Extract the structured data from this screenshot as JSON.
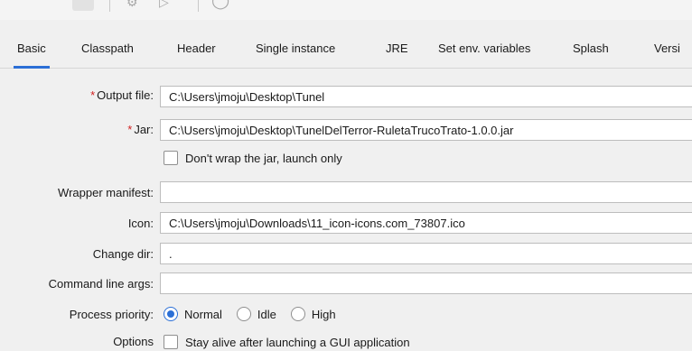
{
  "tabs": [
    {
      "label": "Basic",
      "active": true
    },
    {
      "label": "Classpath"
    },
    {
      "label": "Header"
    },
    {
      "label": "Single instance"
    },
    {
      "label": "JRE"
    },
    {
      "label": "Set env. variables"
    },
    {
      "label": "Splash"
    },
    {
      "label": "Versi"
    }
  ],
  "form": {
    "output_file": {
      "label": "Output file:",
      "required": "*",
      "value": "C:\\Users\\jmoju\\Desktop\\Tunel"
    },
    "jar": {
      "label": "Jar:",
      "required": "*",
      "value": "C:\\Users\\jmoju\\Desktop\\TunelDelTerror-RuletaTrucoTrato-1.0.0.jar"
    },
    "dont_wrap": {
      "label": "Don't wrap the jar, launch only",
      "checked": false
    },
    "wrapper_manifest": {
      "label": "Wrapper manifest:",
      "value": ""
    },
    "icon": {
      "label": "Icon:",
      "value": "C:\\Users\\jmoju\\Downloads\\11_icon-icons.com_73807.ico"
    },
    "change_dir": {
      "label": "Change dir:",
      "value": "."
    },
    "command_line_args": {
      "label": "Command line args:",
      "value": ""
    },
    "process_priority": {
      "label": "Process priority:",
      "options": [
        {
          "label": "Normal",
          "selected": true
        },
        {
          "label": "Idle",
          "selected": false
        },
        {
          "label": "High",
          "selected": false
        }
      ]
    },
    "options": {
      "label": "Options",
      "stay_alive": {
        "label": "Stay alive after launching a GUI application",
        "checked": false
      }
    }
  },
  "colors": {
    "accent": "#2b6fd6",
    "required": "#d11f1f",
    "field_border": "#bdbdbd"
  }
}
